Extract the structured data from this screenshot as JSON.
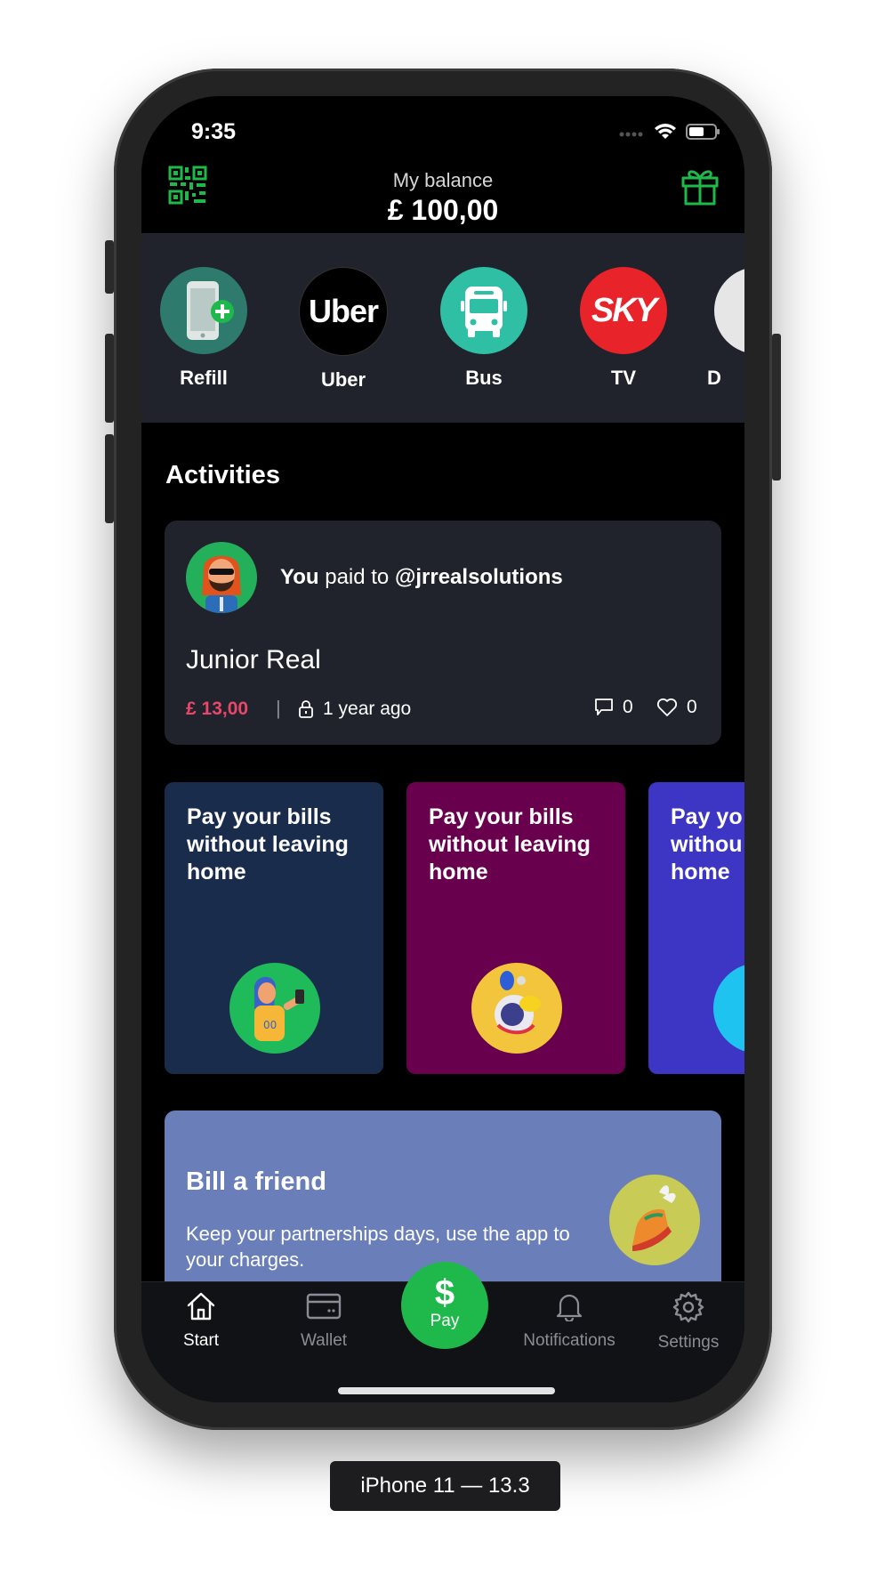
{
  "status": {
    "time": "9:35"
  },
  "header": {
    "balance_label": "My balance",
    "balance_value": "£ 100,00"
  },
  "shortcuts": [
    {
      "label": "Refill",
      "icon": "phone-plus-icon",
      "color": "#2e7b6d"
    },
    {
      "label": "Uber",
      "icon": "uber-logo",
      "logo_text": "Uber",
      "color": "#000000"
    },
    {
      "label": "Bus",
      "icon": "bus-icon",
      "color": "#2ebfa5"
    },
    {
      "label": "TV",
      "icon": "sky-logo",
      "logo_text": "SKY",
      "color": "#e8232a"
    },
    {
      "label": "D",
      "icon": "partial-icon",
      "color": "#e6e6e6"
    }
  ],
  "activities": {
    "title": "Activities",
    "card": {
      "you": "You",
      "paid_to": " paid to ",
      "handle": "@jrrealsolutions",
      "name": "Junior Real",
      "amount": "£ 13,00",
      "separator": "|",
      "time": "1 year ago",
      "comments": "0",
      "likes": "0"
    }
  },
  "promos": [
    {
      "lines": [
        "Pay your bills",
        "without leaving",
        "home"
      ],
      "bg": "#1a2c4b",
      "img_bg": "#1fbb5a"
    },
    {
      "lines": [
        "Pay your bills",
        "without leaving",
        "home"
      ],
      "bg": "#68004d",
      "img_bg": "#f2c53d"
    },
    {
      "lines": [
        "Pay yo",
        "withou",
        "home"
      ],
      "bg": "#3d35c4",
      "img_bg": "#1ec3ef"
    }
  ],
  "bill": {
    "title": "Bill a friend",
    "description": "Keep your partnerships days, use the app to your charges."
  },
  "tabbar": {
    "start": "Start",
    "wallet": "Wallet",
    "pay_symbol": "$",
    "pay": "Pay",
    "notifications": "Notifications",
    "settings": "Settings"
  },
  "device_label": "iPhone 11 — 13.3",
  "colors": {
    "accent": "#1fb84a",
    "amount": "#e9476a",
    "card_bg": "#20232c"
  }
}
